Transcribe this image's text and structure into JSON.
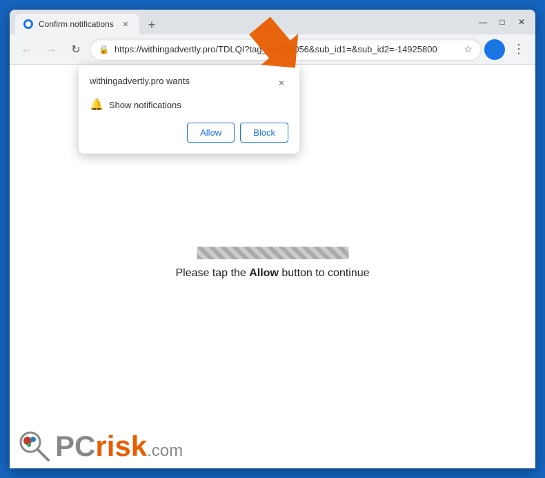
{
  "browser": {
    "title": "Confirm notifications",
    "tab": {
      "label": "Confirm notifications",
      "favicon": "globe"
    },
    "new_tab_label": "+",
    "window_controls": {
      "minimize": "—",
      "maximize": "□",
      "close": "✕"
    },
    "nav": {
      "back": "←",
      "forward": "→",
      "refresh": "↻"
    },
    "address_bar": {
      "url": "https://withingadvertly.pro/TDLQI?tag_id=709056&sub_id1=&sub_id2=-14925800",
      "lock_icon": "🔒"
    },
    "profile_icon": "👤",
    "menu_icon": "⋮"
  },
  "popup": {
    "site_name": "withingadvertly.pro wants ",
    "close_icon": "×",
    "permission_text": "Show notifications",
    "bell_icon": "🔔",
    "allow_button": "Allow",
    "block_button": "Block"
  },
  "page": {
    "instruction_text_prefix": "Please tap the ",
    "instruction_highlight": "Allow",
    "instruction_text_suffix": " button to continue"
  },
  "logo": {
    "pc": "PC",
    "risk": "risk",
    "dot": ".",
    "com": "com"
  }
}
